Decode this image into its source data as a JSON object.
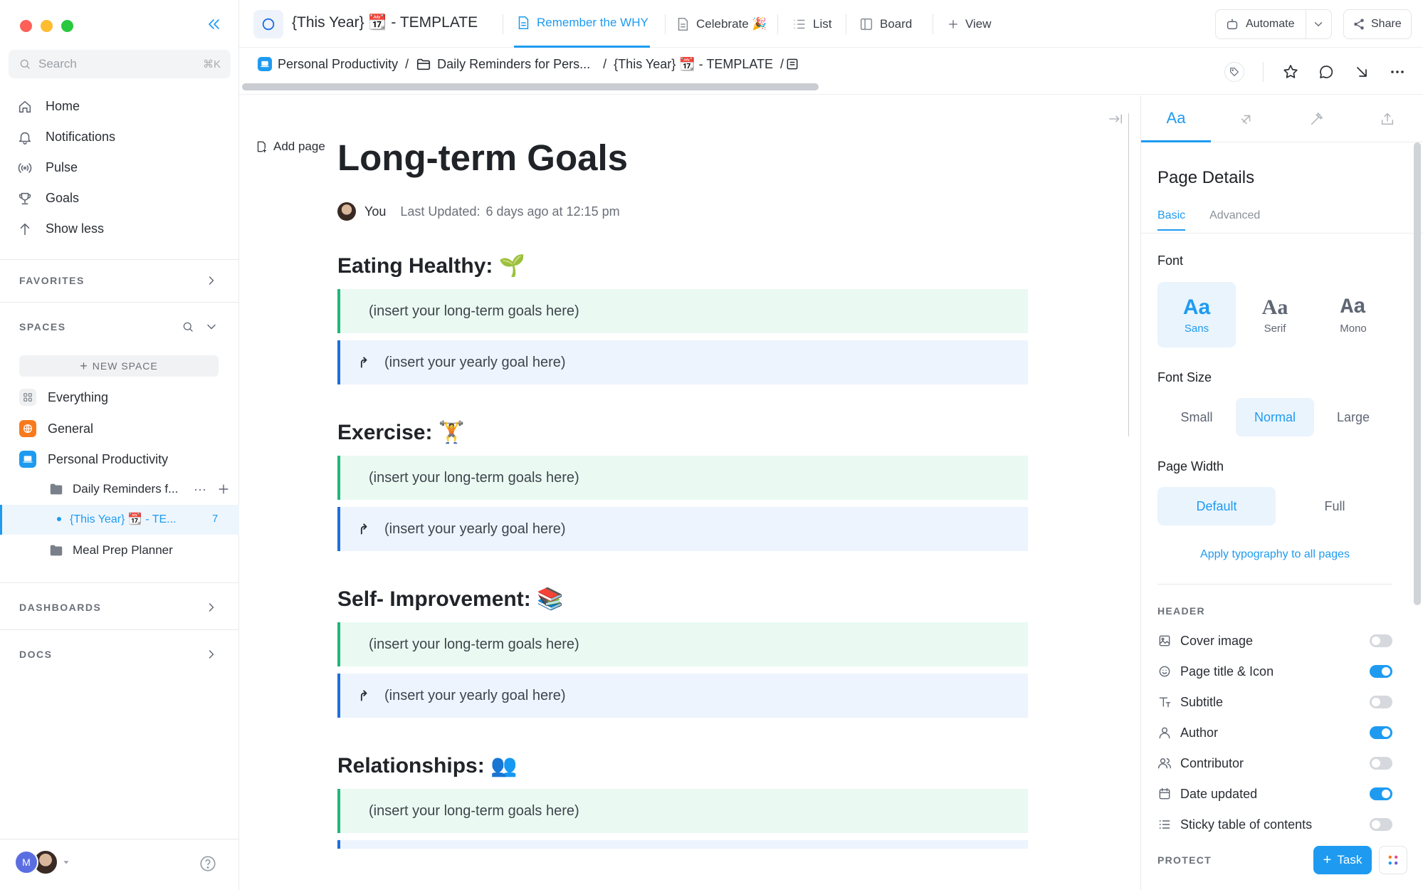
{
  "sidebar": {
    "search": {
      "placeholder": "Search",
      "shortcut": "⌘K"
    },
    "nav": [
      {
        "label": "Home",
        "icon": "home-icon"
      },
      {
        "label": "Notifications",
        "icon": "bell-icon"
      },
      {
        "label": "Pulse",
        "icon": "pulse-icon"
      },
      {
        "label": "Goals",
        "icon": "trophy-icon"
      },
      {
        "label": "Show less",
        "icon": "arrow-up-icon"
      }
    ],
    "favorites_label": "FAVORITES",
    "spaces_label": "SPACES",
    "new_space_label": "NEW SPACE",
    "spaces": [
      {
        "label": "Everything"
      },
      {
        "label": "General"
      },
      {
        "label": "Personal Productivity"
      }
    ],
    "folder": {
      "label": "Daily Reminders f...",
      "more": "···"
    },
    "selected_list": {
      "label": "{This Year} 📆 - TE...",
      "count": "7"
    },
    "meal_folder": {
      "label": "Meal Prep Planner"
    },
    "dashboards_label": "DASHBOARDS",
    "docs_label": "DOCS",
    "user_initial": "M"
  },
  "topbar": {
    "title": "{This Year} 📆 - TEMPLATE",
    "tabs": [
      {
        "label": "Remember the WHY",
        "active": true
      },
      {
        "label": "Celebrate 🎉",
        "active": false
      },
      {
        "label": "List",
        "active": false
      },
      {
        "label": "Board",
        "active": false
      }
    ],
    "add_view_label": "View",
    "automate_label": "Automate",
    "share_label": "Share"
  },
  "breadcrumbs": {
    "items": [
      "Personal Productivity",
      "Daily Reminders for Pers...",
      "{This Year} 📆 - TEMPLATE"
    ],
    "sep": "/"
  },
  "doc": {
    "add_page_label": "Add page",
    "title": "Long-term Goals",
    "author": "You",
    "last_updated_label": "Last Updated:",
    "last_updated_value": "6 days ago at 12:15 pm",
    "sections": [
      {
        "heading": "Eating Healthy: 🌱",
        "goal": "(insert your long-term goals here)",
        "yearly": "(insert your yearly goal here)"
      },
      {
        "heading": "Exercise: 🏋️",
        "goal": "(insert your long-term goals here)",
        "yearly": "(insert your yearly goal here)"
      },
      {
        "heading": "Self- Improvement: 📚",
        "goal": "(insert your long-term goals here)",
        "yearly": "(insert your yearly goal here)"
      },
      {
        "heading": "Relationships: 👥",
        "goal": "(insert your long-term goals here)"
      }
    ]
  },
  "panel": {
    "title": "Page Details",
    "subtab_basic": "Basic",
    "subtab_advanced": "Advanced",
    "font_label": "Font",
    "fonts": [
      {
        "glyph": "Aa",
        "name": "Sans",
        "selected": true
      },
      {
        "glyph": "Aa",
        "name": "Serif",
        "selected": false
      },
      {
        "glyph": "Aa",
        "name": "Mono",
        "selected": false
      }
    ],
    "font_size_label": "Font Size",
    "sizes": [
      "Small",
      "Normal",
      "Large"
    ],
    "selected_size": "Normal",
    "page_width_label": "Page Width",
    "widths": [
      "Default",
      "Full"
    ],
    "selected_width": "Default",
    "apply_label": "Apply typography to all pages",
    "header_label": "HEADER",
    "toggles": [
      {
        "label": "Cover image",
        "on": false,
        "icon": "image-icon"
      },
      {
        "label": "Page title & Icon",
        "on": true,
        "icon": "smiley-icon"
      },
      {
        "label": "Subtitle",
        "on": false,
        "icon": "text-icon"
      },
      {
        "label": "Author",
        "on": true,
        "icon": "user-icon"
      },
      {
        "label": "Contributor",
        "on": false,
        "icon": "users-icon"
      },
      {
        "label": "Date updated",
        "on": true,
        "icon": "calendar-icon"
      },
      {
        "label": "Sticky table of contents",
        "on": false,
        "icon": "list-icon"
      }
    ],
    "protect_label": "PROTECT",
    "task_label": "Task",
    "tab_aa": "Aa"
  },
  "colors": {
    "accent": "#1e9bf0",
    "green_callout": "#eafaf2",
    "blue_callout": "#edf4fd"
  }
}
